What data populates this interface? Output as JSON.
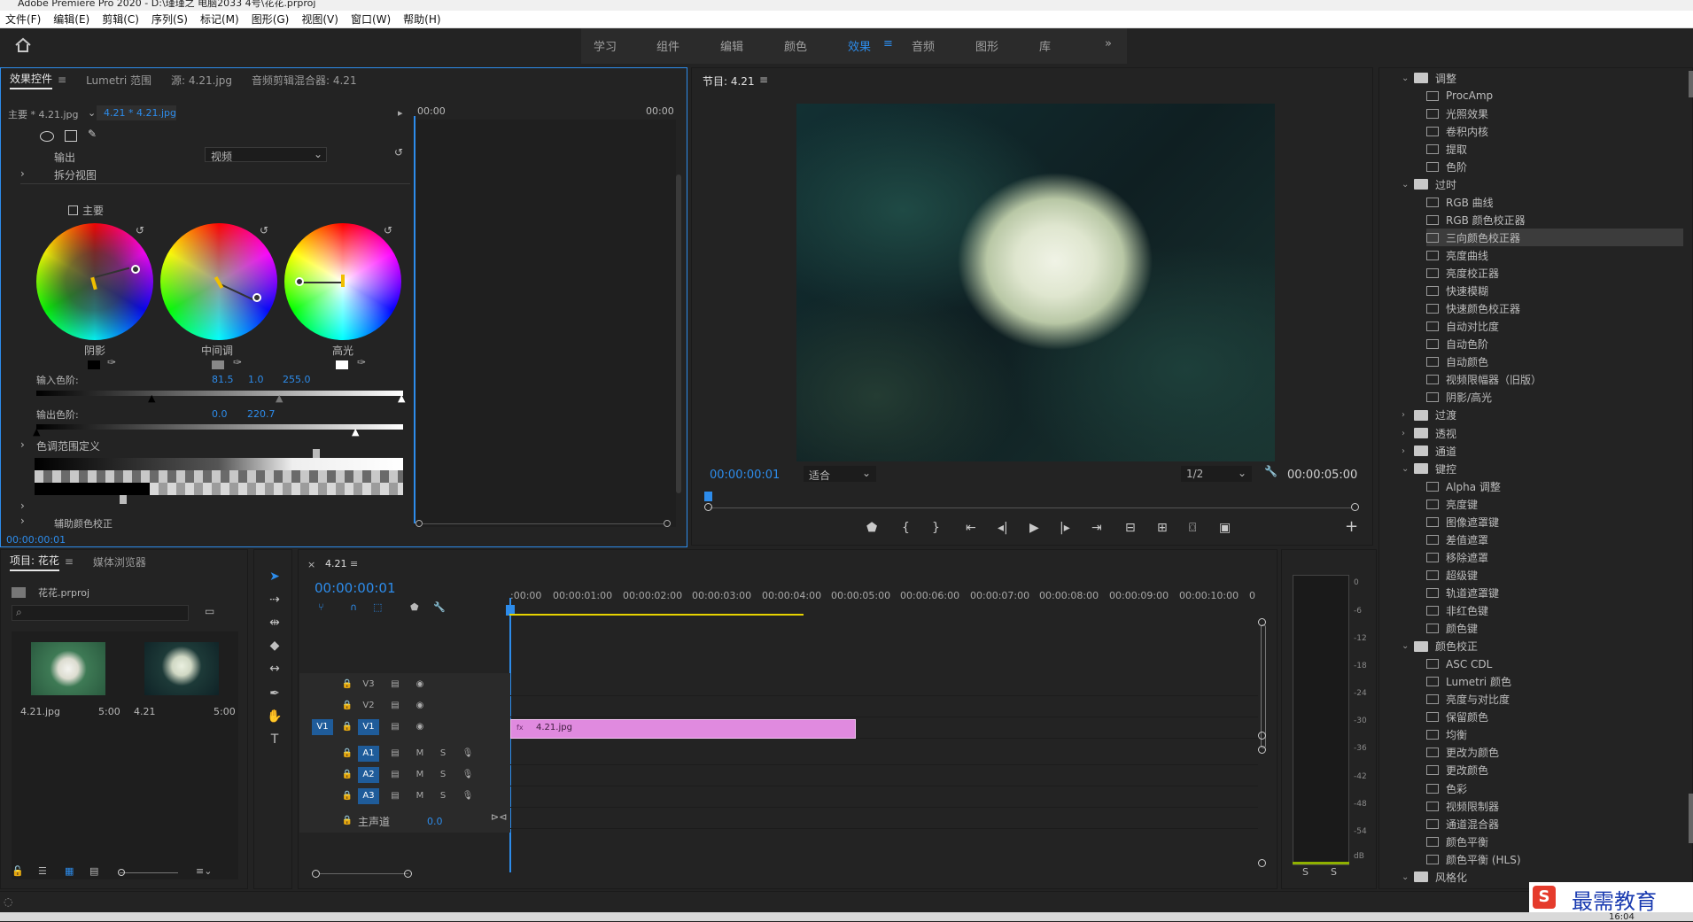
{
  "app": {
    "title": "Adobe Premiere Pro 2020 - D:\\瑾瑾之 电脑2033 4号\\花花.prproj"
  },
  "menu": [
    "文件(F)",
    "编辑(E)",
    "剪辑(C)",
    "序列(S)",
    "标记(M)",
    "图形(G)",
    "视图(V)",
    "窗口(W)",
    "帮助(H)"
  ],
  "workspaces": {
    "tabs": [
      "学习",
      "组件",
      "编辑",
      "颜色",
      "效果",
      "音频",
      "图形",
      "库"
    ],
    "active": "效果",
    "more": "»"
  },
  "effect_controls": {
    "tabs": [
      "效果控件",
      "Lumetri 范围",
      "源: 4.21.jpg",
      "音频剪辑混合器: 4.21"
    ],
    "master_clip": "主要 * 4.21.jpg",
    "seq_clip": "4.21 * 4.21.jpg",
    "time_start": "00:00",
    "time_end": "00:00",
    "output_label": "输出",
    "output_value": "视频",
    "split_view": "拆分视图",
    "master_checkbox": "主要",
    "wheels": [
      {
        "label": "阴影"
      },
      {
        "label": "中间调"
      },
      {
        "label": "高光"
      }
    ],
    "input_levels_label": "输入色阶:",
    "input_levels_values": [
      "81.5",
      "1.0",
      "255.0"
    ],
    "output_levels_label": "输出色阶:",
    "output_levels_values": [
      "0.0",
      "220.7"
    ],
    "tone_range": "色调范围定义",
    "aux_color": "辅助颜色校正",
    "footer_time": "00:00:00:01"
  },
  "program": {
    "title": "节目: 4.21",
    "timecode": "00:00:00:01",
    "fit": "适合",
    "resolution": "1/2",
    "duration": "00:00:05:00"
  },
  "project": {
    "tabs": [
      "项目: 花花",
      "媒体浏览器"
    ],
    "file": "花花.prproj",
    "items": [
      {
        "name": "4.21.jpg",
        "duration": "5:00"
      },
      {
        "name": "4.21",
        "duration": "5:00"
      }
    ]
  },
  "timeline": {
    "tab": "4.21",
    "timecode": "00:00:00:01",
    "ruler": [
      ":00:00",
      "00:00:01:00",
      "00:00:02:00",
      "00:00:03:00",
      "00:00:04:00",
      "00:00:05:00",
      "00:00:06:00",
      "00:00:07:00",
      "00:00:08:00",
      "00:00:09:00",
      "00:00:10:00",
      "0"
    ],
    "video_tracks": [
      "V3",
      "V2",
      "V1"
    ],
    "audio_tracks": [
      "A1",
      "A2",
      "A3"
    ],
    "source_v": "V1",
    "clip_name": "4.21.jpg",
    "master_label": "主声道",
    "master_value": "0.0",
    "m": "M",
    "s": "S"
  },
  "meter": {
    "labels": [
      "0",
      "-6",
      "-12",
      "-18",
      "-24",
      "-30",
      "-36",
      "-42",
      "-48",
      "-54",
      "dB"
    ],
    "solo": [
      "S",
      "S"
    ]
  },
  "effects_tree": [
    {
      "kind": "folder",
      "label": "调整",
      "open": true
    },
    {
      "kind": "item",
      "label": "ProcAmp"
    },
    {
      "kind": "item",
      "label": "光照效果"
    },
    {
      "kind": "item",
      "label": "卷积内核"
    },
    {
      "kind": "item",
      "label": "提取"
    },
    {
      "kind": "item",
      "label": "色阶"
    },
    {
      "kind": "folder",
      "label": "过时",
      "open": true
    },
    {
      "kind": "item",
      "label": "RGB 曲线"
    },
    {
      "kind": "item",
      "label": "RGB 颜色校正器"
    },
    {
      "kind": "item",
      "label": "三向颜色校正器",
      "selected": true
    },
    {
      "kind": "item",
      "label": "亮度曲线"
    },
    {
      "kind": "item",
      "label": "亮度校正器"
    },
    {
      "kind": "item",
      "label": "快速模糊"
    },
    {
      "kind": "item",
      "label": "快速颜色校正器"
    },
    {
      "kind": "item",
      "label": "自动对比度"
    },
    {
      "kind": "item",
      "label": "自动色阶"
    },
    {
      "kind": "item",
      "label": "自动颜色"
    },
    {
      "kind": "item",
      "label": "视频限幅器（旧版）"
    },
    {
      "kind": "item",
      "label": "阴影/高光"
    },
    {
      "kind": "folder",
      "label": "过渡",
      "open": false
    },
    {
      "kind": "folder",
      "label": "透视",
      "open": false
    },
    {
      "kind": "folder",
      "label": "通道",
      "open": false
    },
    {
      "kind": "folder",
      "label": "键控",
      "open": true
    },
    {
      "kind": "item",
      "label": "Alpha 调整"
    },
    {
      "kind": "item",
      "label": "亮度键"
    },
    {
      "kind": "item",
      "label": "图像遮罩键"
    },
    {
      "kind": "item",
      "label": "差值遮罩"
    },
    {
      "kind": "item",
      "label": "移除遮罩"
    },
    {
      "kind": "item",
      "label": "超级键"
    },
    {
      "kind": "item",
      "label": "轨道遮罩键"
    },
    {
      "kind": "item",
      "label": "非红色键"
    },
    {
      "kind": "item",
      "label": "颜色键"
    },
    {
      "kind": "folder",
      "label": "颜色校正",
      "open": true
    },
    {
      "kind": "item",
      "label": "ASC CDL"
    },
    {
      "kind": "item",
      "label": "Lumetri 颜色"
    },
    {
      "kind": "item",
      "label": "亮度与对比度"
    },
    {
      "kind": "item",
      "label": "保留颜色"
    },
    {
      "kind": "item",
      "label": "均衡"
    },
    {
      "kind": "item",
      "label": "更改为颜色"
    },
    {
      "kind": "item",
      "label": "更改颜色"
    },
    {
      "kind": "item",
      "label": "色彩"
    },
    {
      "kind": "item",
      "label": "视频限制器"
    },
    {
      "kind": "item",
      "label": "通道混合器"
    },
    {
      "kind": "item",
      "label": "颜色平衡"
    },
    {
      "kind": "item",
      "label": "颜色平衡 (HLS)"
    },
    {
      "kind": "folder",
      "label": "风格化",
      "open": true
    }
  ],
  "watermark": "最需教育",
  "clock": "16:04",
  "colors": {
    "accent": "#2d8ceb",
    "clip": "#e08adf",
    "bg": "#232323"
  }
}
